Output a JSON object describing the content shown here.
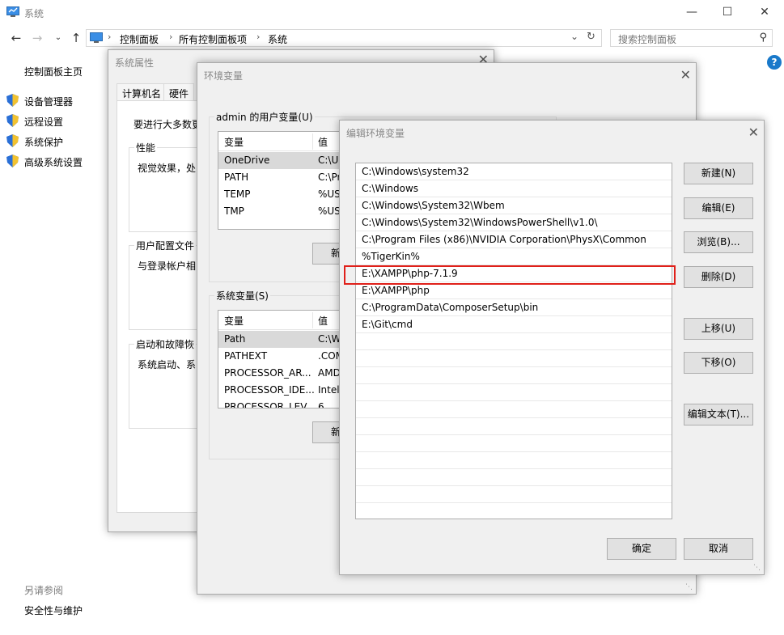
{
  "window": {
    "title": "系统"
  },
  "address": {
    "crumbs": [
      "控制面板",
      "所有控制面板项",
      "系统"
    ],
    "search_placeholder": "搜索控制面板"
  },
  "left_nav": {
    "home": "控制面板主页",
    "items": [
      "设备管理器",
      "远程设置",
      "系统保护",
      "高级系统设置"
    ],
    "see_also": "另请参阅",
    "security": "安全性与维护"
  },
  "sysprops": {
    "title": "系统属性",
    "tabs": [
      "计算机名",
      "硬件"
    ],
    "intro": "要进行大多数更",
    "perf_legend": "性能",
    "perf_text": "视觉效果，处",
    "profile_legend": "用户配置文件",
    "profile_text": "与登录帐户相",
    "startup_legend": "启动和故障恢",
    "startup_text": "系统启动、系"
  },
  "envvars": {
    "title": "环境变量",
    "user_group": "admin 的用户变量(U)",
    "sys_group": "系统变量(S)",
    "col_var": "变量",
    "col_val": "值",
    "user_rows": [
      {
        "name": "OneDrive",
        "value": "C:\\U"
      },
      {
        "name": "PATH",
        "value": "C:\\Pr"
      },
      {
        "name": "TEMP",
        "value": "%US"
      },
      {
        "name": "TMP",
        "value": "%US"
      }
    ],
    "sys_rows": [
      {
        "name": "Path",
        "value": "C:\\W"
      },
      {
        "name": "PATHEXT",
        "value": ".COM"
      },
      {
        "name": "PROCESSOR_AR...",
        "value": "AMD"
      },
      {
        "name": "PROCESSOR_IDE...",
        "value": "Intel"
      },
      {
        "name": "PROCESSOR_LEV...",
        "value": "6"
      }
    ],
    "new_btn": "新建"
  },
  "editenv": {
    "title": "编辑环境变量",
    "paths": [
      "C:\\Windows\\system32",
      "C:\\Windows",
      "C:\\Windows\\System32\\Wbem",
      "C:\\Windows\\System32\\WindowsPowerShell\\v1.0\\",
      "C:\\Program Files (x86)\\NVIDIA Corporation\\PhysX\\Common",
      "%TigerKin%",
      "E:\\XAMPP\\php-7.1.9",
      "E:\\XAMPP\\php",
      "C:\\ProgramData\\ComposerSetup\\bin",
      "E:\\Git\\cmd"
    ],
    "buttons": {
      "new": "新建(N)",
      "edit": "编辑(E)",
      "browse": "浏览(B)...",
      "delete": "删除(D)",
      "up": "上移(U)",
      "down": "下移(O)",
      "edit_text": "编辑文本(T)...",
      "ok": "确定",
      "cancel": "取消"
    },
    "highlight_color": "#e0201a"
  }
}
